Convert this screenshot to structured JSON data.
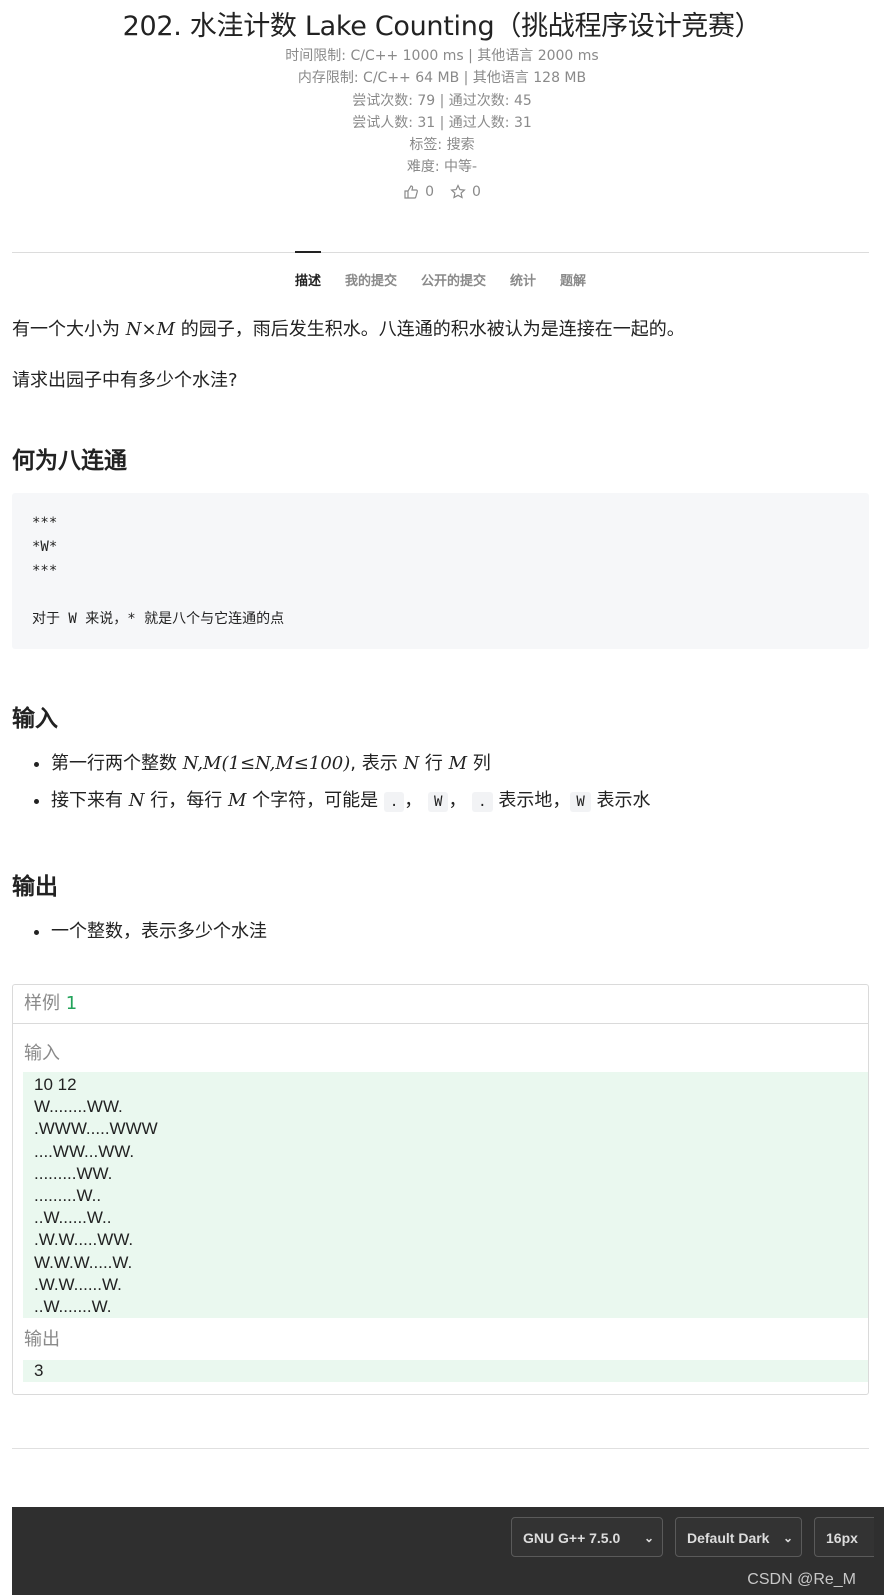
{
  "problem": {
    "title": "202. 水洼计数 Lake Counting（挑战程序设计竞赛）",
    "meta": [
      "时间限制: C/C++ 1000 ms | 其他语言 2000 ms",
      "内存限制: C/C++ 64 MB | 其他语言 128 MB",
      "尝试次数: 79 | 通过次数: 45",
      "尝试人数: 31 | 通过人数: 31",
      "标签: 搜索",
      "难度: 中等-"
    ],
    "likes": "0",
    "stars": "0"
  },
  "tabs": [
    "描述",
    "我的提交",
    "公开的提交",
    "统计",
    "题解"
  ],
  "description": {
    "p1_before": "有一个大小为 ",
    "p1_math": "N×M",
    "p1_after": " 的园子，雨后发生积水。八连通的积水被认为是连接在一起的。",
    "p2": "请求出园子中有多少个水洼?",
    "h_connect": "何为八连通",
    "code_block": "***\n*W*\n***\n\n对于 W 来说，* 就是八个与它连通的点",
    "h_input": "输入",
    "input_li1_a": "第一行两个整数 ",
    "input_li1_math": "N,M(1≤N,M≤100)",
    "input_li1_b": ", 表示 ",
    "input_li1_n": "N",
    "input_li1_c": " 行 ",
    "input_li1_m": "M",
    "input_li1_d": " 列",
    "input_li2_a": "接下来有 ",
    "input_li2_n": "N",
    "input_li2_b": " 行，每行 ",
    "input_li2_m": "M",
    "input_li2_c": " 个字符，可能是 ",
    "input_li2_code1": ".",
    "input_li2_sep1": "，",
    "input_li2_code2": "W",
    "input_li2_sep2": "，",
    "input_li2_code3": ".",
    "input_li2_d": " 表示地，",
    "input_li2_code4": "W",
    "input_li2_e": " 表示水",
    "h_output": "输出",
    "output_li1": "一个整数，表示多少个水洼"
  },
  "sample": {
    "label": "样例",
    "number": "1",
    "input_label": "输入",
    "input": "10 12\nW........WW.\n.WWW.....WWW\n....WW...WW.\n.........WW.\n.........W..\n..W......W..\n.W.W.....WW.\nW.W.W.....W.\n.W.W......W.\n..W.......W.",
    "output_label": "输出",
    "output": "3"
  },
  "toolbar": {
    "compiler": "GNU G++ 7.5.0",
    "theme": "Default Dark",
    "font_size": "16px"
  },
  "watermark": "CSDN @Re_M"
}
